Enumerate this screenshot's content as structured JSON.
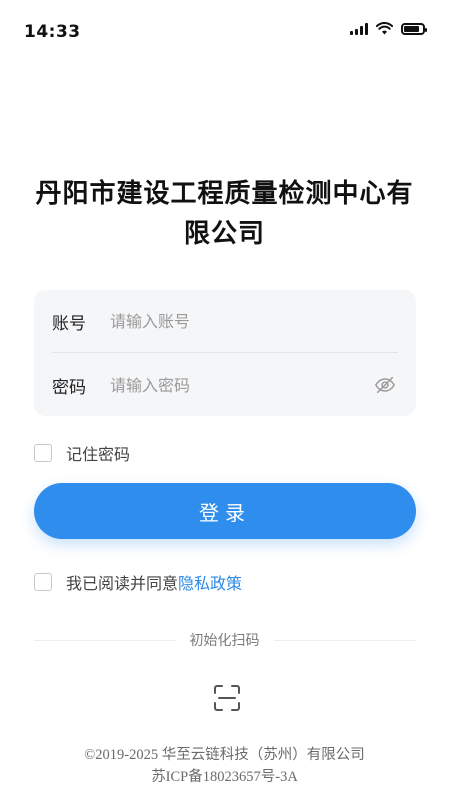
{
  "status_bar": {
    "time": "14:33",
    "battery_level": 0.85
  },
  "title": {
    "line1": "丹阳市建设工程质量检测中心有",
    "line2": "限公司"
  },
  "form": {
    "account_label": "账号",
    "account_placeholder": "请输入账号",
    "password_label": "密码",
    "password_placeholder": "请输入密码"
  },
  "remember_password": {
    "label": "记住密码",
    "checked": false
  },
  "login_button": {
    "label": "登录",
    "color": "#2e8ded"
  },
  "agreement": {
    "text": "我已阅读并同意",
    "link": "隐私政策",
    "checked": false,
    "link_color": "#2b8be8"
  },
  "init_scan": {
    "label": "初始化扫码",
    "icon": "scan-icon"
  },
  "footer": {
    "copyright": "©2019-2025 华至云链科技（苏州）有限公司",
    "icp": "苏ICP备18023657号-3A"
  }
}
